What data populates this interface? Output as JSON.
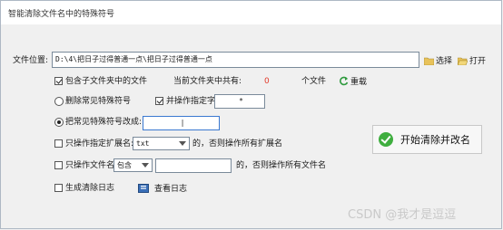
{
  "window": {
    "title": "智能清除文件名中的特殊符号"
  },
  "path": {
    "label": "文件位置:",
    "value": "D:\\4\\把日子过得普通一点\\把日子过得普通一点",
    "choose": "选择",
    "open": "打开"
  },
  "include_sub": {
    "label": "包含子文件夹中的文件",
    "checked": true
  },
  "count": {
    "label": "当前文件夹中共有:",
    "value": "0",
    "unit": "个文件",
    "reload": "重载"
  },
  "delete_common": {
    "label": "删除常见特殊符号",
    "selected": false
  },
  "delete_specified": {
    "label": "并操作指定字符:",
    "checked": true,
    "value": "*"
  },
  "replace_common": {
    "label": "把常见特殊符号改成:",
    "selected": true,
    "value": "|"
  },
  "only_ext": {
    "label": "只操作指定扩展名:",
    "checked": false,
    "value": "txt",
    "suffix": "的，否则操作所有扩展名"
  },
  "only_name": {
    "label": "只操作文件名",
    "checked": false,
    "mode": "包含",
    "value": "",
    "suffix": "的，否则操作所有文件名"
  },
  "log": {
    "label": "生成清除日志",
    "checked": false,
    "view": "查看日志"
  },
  "start": {
    "label": "开始清除并改名"
  },
  "watermark": "CSDN @我才是逗逗",
  "colors": {
    "count_value": "#e23a2a",
    "start_icon": "#3fae3f"
  }
}
